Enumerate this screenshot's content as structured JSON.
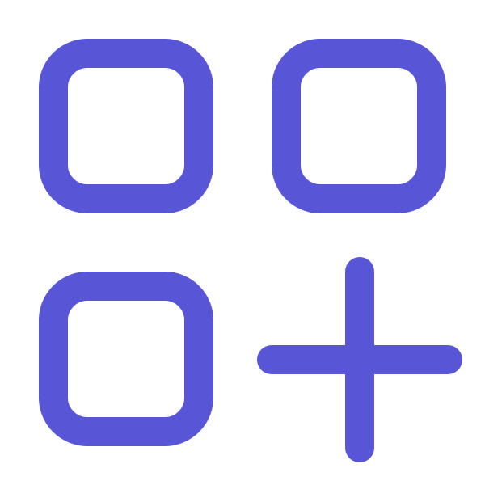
{
  "icon": {
    "name": "add-app-icon",
    "accent_color": "#5856D6",
    "background_color": "#FFFFFF"
  }
}
